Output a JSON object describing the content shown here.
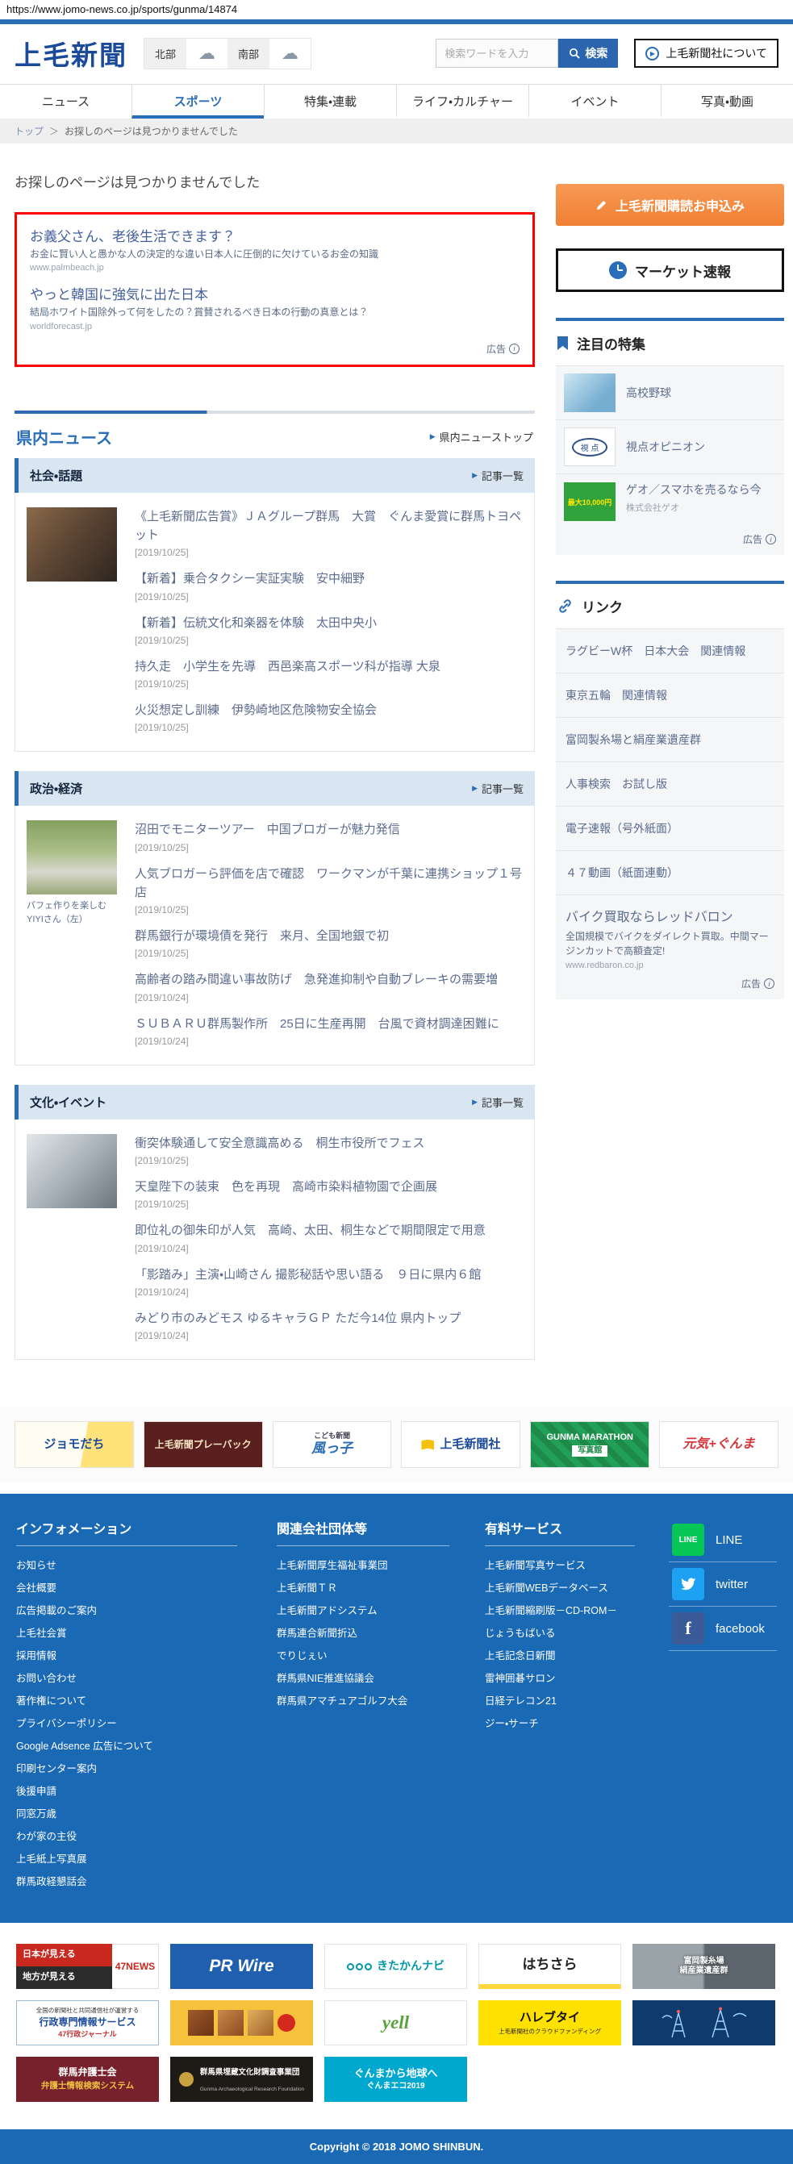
{
  "page": {
    "url": "https://www.jomo-news.co.jp/sports/gunma/14874"
  },
  "header": {
    "logo": "上毛新聞",
    "weather": {
      "north": "北部",
      "south": "南部"
    },
    "search_placeholder": "検索ワードを入力",
    "search_button": "検索",
    "about_button": "上毛新聞社について"
  },
  "nav": {
    "items": [
      {
        "label": "ニュース"
      },
      {
        "label": "スポーツ"
      },
      {
        "label": "特集・連載"
      },
      {
        "label": "ライフ・カルチャー"
      },
      {
        "label": "イベント"
      },
      {
        "label": "写真・動画"
      }
    ]
  },
  "breadcrumb": {
    "home": "トップ",
    "separator": "＞",
    "current": "お探しのページは見つかりませんでした"
  },
  "main": {
    "not_found_message": "お探しのページは見つかりませんでした",
    "ad_box": {
      "ad_label": "広告",
      "ads": [
        {
          "title": "お義父さん、老後生活できます？",
          "description": "お金に賢い人と愚かな人の決定的な違い日本人に圧倒的に欠けているお金の知識",
          "url": "www.palmbeach.jp"
        },
        {
          "title": "やっと韓国に強気に出た日本",
          "description": "結局ホワイト国除外って何をしたの？賞賛されるべき日本の行動の真意とは？",
          "url": "worldforecast.jp"
        }
      ]
    },
    "section": {
      "title": "県内ニュース",
      "top_link": "県内ニューストップ",
      "list_link": "記事一覧"
    },
    "categories": [
      {
        "title": "社会・話題",
        "articles": [
          {
            "title": "《上毛新聞広告賞》ＪＡグループ群馬　大賞　ぐんま愛賞に群馬トヨペット",
            "date": "[2019/10/25]"
          },
          {
            "title": "【新着】乗合タクシー実証実験　安中細野",
            "date": "[2019/10/25]"
          },
          {
            "title": "【新着】伝統文化和楽器を体験　太田中央小",
            "date": "[2019/10/25]"
          },
          {
            "title": "持久走　小学生を先導　西邑楽高スポーツ科が指導 大泉",
            "date": "[2019/10/25]"
          },
          {
            "title": "火災想定し訓練　伊勢崎地区危険物安全協会",
            "date": "[2019/10/25]"
          }
        ]
      },
      {
        "title": "政治・経済",
        "photo_caption": "パフェ作りを楽しむYIYIさん（左）",
        "articles": [
          {
            "title": "沼田でモニターツアー　中国ブロガーが魅力発信",
            "date": "[2019/10/25]"
          },
          {
            "title": "人気ブロガーら評価を店で確認　ワークマンが千葉に連携ショップ１号店",
            "date": "[2019/10/25]"
          },
          {
            "title": "群馬銀行が環境債を発行　来月、全国地銀で初",
            "date": "[2019/10/25]"
          },
          {
            "title": "高齢者の踏み間違い事故防げ　急発進抑制や自動ブレーキの需要増",
            "date": "[2019/10/24]"
          },
          {
            "title": "ＳＵＢＡＲＵ群馬製作所　25日に生産再開　台風で資材調達困難に",
            "date": "[2019/10/24]"
          }
        ]
      },
      {
        "title": "文化・イベント",
        "articles": [
          {
            "title": "衝突体験通して安全意識高める　桐生市役所でフェス",
            "date": "[2019/10/25]"
          },
          {
            "title": "天皇陛下の装束　色を再現　高崎市染料植物園で企画展",
            "date": "[2019/10/25]"
          },
          {
            "title": "即位礼の御朱印が人気　高崎、太田、桐生などで期間限定で用意",
            "date": "[2019/10/24]"
          },
          {
            "title": "「影踏み」主演・山崎さん 撮影秘話や思い語る　９日に県内６館",
            "date": "[2019/10/24]"
          },
          {
            "title": "みどり市のみどモス ゆるキャラＧＰ ただ今14位 県内トップ",
            "date": "[2019/10/24]"
          }
        ]
      }
    ]
  },
  "sidebar": {
    "subscribe_button": "上毛新聞購読お申込み",
    "market_button": "マーケット速報",
    "featured": {
      "title": "注目の特集",
      "items": [
        {
          "label": "高校野球"
        },
        {
          "label": "視点オピニオン"
        }
      ],
      "ad": {
        "title": "ゲオ／スマホを売るなら今",
        "advertiser": "株式会社ゲオ",
        "thumb_text": "最大10,000円",
        "ad_label": "広告"
      }
    },
    "links": {
      "title": "リンク",
      "items": [
        {
          "label": "ラグビーW杯　日本大会　関連情報"
        },
        {
          "label": "東京五輪　関連情報"
        },
        {
          "label": "富岡製糸場と絹産業遺産群"
        },
        {
          "label": "人事検索　お試し版"
        },
        {
          "label": "電子速報（号外紙面）"
        },
        {
          "label": "４７動画（紙面連動）"
        }
      ],
      "ad": {
        "title": "バイク買取ならレッドバロン",
        "description": "全国規模でバイクをダイレクト買取。中間マージンカットで高額査定!",
        "url": "www.redbaron.co.jp",
        "ad_label": "広告"
      }
    }
  },
  "partner_banners": [
    {
      "label": "ジョモだち"
    },
    {
      "label": "上毛新聞プレーバック"
    },
    {
      "label": "風っ子",
      "sub": "こども新聞"
    },
    {
      "label": "上毛新聞社"
    },
    {
      "label": "GUNMA MARATHON",
      "sub": "写真館"
    },
    {
      "label": "元気+ぐんま"
    }
  ],
  "footer": {
    "columns": [
      {
        "title": "インフォメーション",
        "links": [
          "お知らせ",
          "会社概要",
          "広告掲載のご案内",
          "上毛社会賞",
          "採用情報",
          "お問い合わせ",
          "著作権について",
          "プライバシーポリシー",
          "Google Adsence 広告について",
          "印刷センター案内",
          "後援申請",
          "同窓万歳",
          "わが家の主役",
          "上毛紙上写真展",
          "群馬政経懇話会"
        ]
      },
      {
        "title": "関連会社団体等",
        "links": [
          "上毛新聞厚生福祉事業団",
          "上毛新聞ＴＲ",
          "上毛新聞アドシステム",
          "群馬連合新聞折込",
          "でりじぇい",
          "群馬県NIE推進協議会",
          "群馬県アマチュアゴルフ大会"
        ]
      },
      {
        "title": "有料サービス",
        "links": [
          "上毛新聞写真サービス",
          "上毛新聞WEBデータベース",
          "上毛新聞縮刷版－CD-ROM－",
          "じょうもばいる",
          "上毛記念日新聞",
          "雷神囲碁サロン",
          "日経テレコン21",
          "ジー・サーチ"
        ]
      }
    ],
    "sns": [
      {
        "label": "LINE"
      },
      {
        "label": "twitter"
      },
      {
        "label": "facebook"
      }
    ]
  },
  "bottom_banners": {
    "b47news": {
      "line1": "日本が見える",
      "line2": "地方が見える",
      "brand": "47NEWS"
    },
    "prwire": {
      "brand": "PR Wire"
    },
    "kitakan": {
      "brand": "きたかんナビ"
    },
    "hachisara": {
      "brand": "はちさら"
    },
    "tomioka": {
      "line1": "富岡製糸場",
      "line2": "絹産業遺産群"
    },
    "gyosei": {
      "line1": "全国の新聞社と共同通信社が運営する",
      "brand": "行政専門情報サービス",
      "line2": "47行政ジャーナル"
    },
    "yell": {
      "brand": "yell"
    },
    "harebutai": {
      "brand": "ハレブタイ",
      "sub": "上毛新聞社のクラウドファンディング"
    },
    "bengoshi": {
      "line1": "群馬弁護士会",
      "line2": "弁護士情報検索システム"
    },
    "maizo": {
      "line1": "群馬県埋蔵文化財調査事業団",
      "line2": "Gunma Archaeological Research Foundation"
    },
    "chikyu": {
      "line1": "ぐんまから地球へ",
      "line2": "ぐんまエコ2019"
    }
  },
  "copyright": "Copyright © 2018 JOMO SHINBUN."
}
